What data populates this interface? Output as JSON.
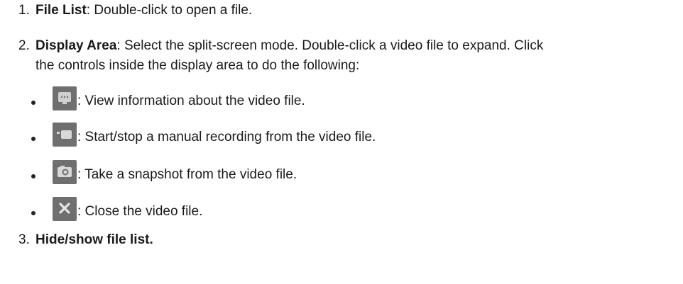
{
  "items": [
    {
      "number": "1.",
      "title": "File List",
      "text": ": Double-click to open a file."
    },
    {
      "number": "2.",
      "title": "Display Area",
      "text": ": Select the split-screen mode. Double-click a video file to expand. Click",
      "continuation": "the controls inside the display area to do the following:"
    },
    {
      "number": "3.",
      "title": "Hide/show file list."
    }
  ],
  "controls": [
    {
      "icon": "info-screen-icon",
      "text": ": View information about the video file."
    },
    {
      "icon": "video-camera-icon",
      "text": ": Start/stop a manual recording from the video file."
    },
    {
      "icon": "camera-icon",
      "text": ": Take a snapshot from the video file."
    },
    {
      "icon": "close-icon",
      "text": ": Close the video file."
    }
  ]
}
